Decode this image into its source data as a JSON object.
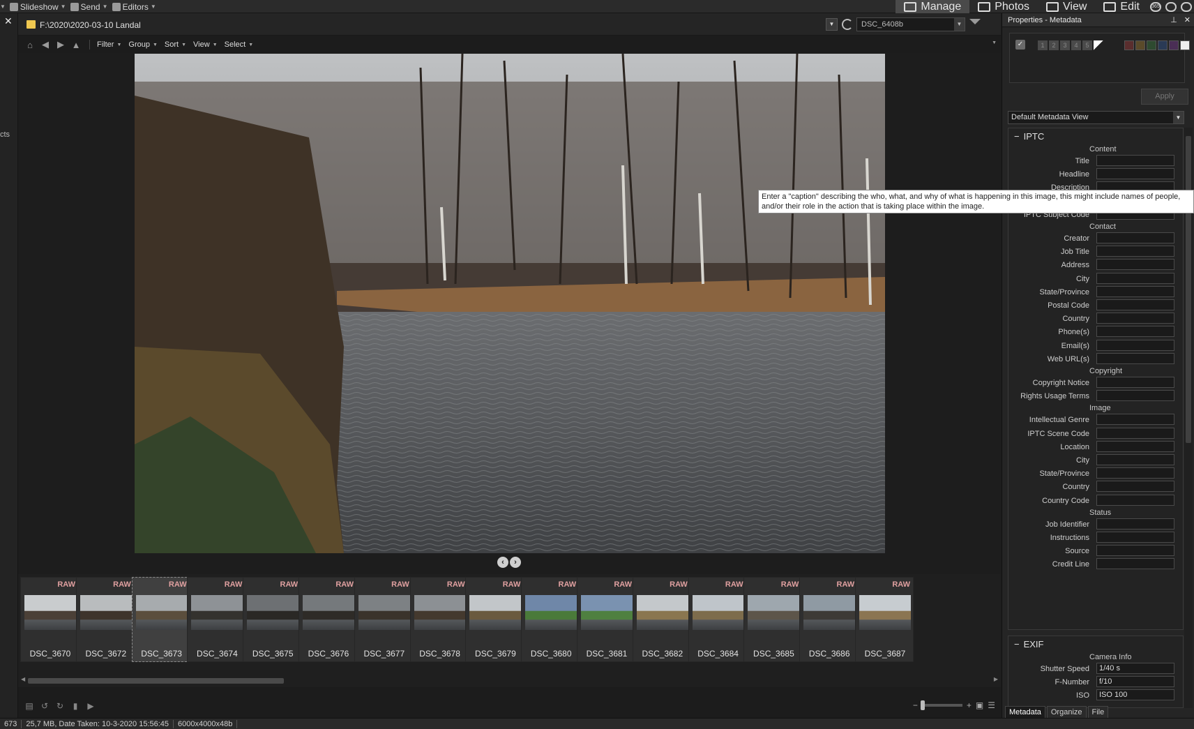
{
  "topbar": {
    "left_items": [
      {
        "label": "Slideshow",
        "icon": "slideshow-icon"
      },
      {
        "label": "Send",
        "icon": "send-icon"
      },
      {
        "label": "Editors",
        "icon": "editors-icon"
      }
    ],
    "modes": [
      {
        "label": "Manage",
        "icon": "grid-icon",
        "active": true
      },
      {
        "label": "Photos",
        "icon": "photos-icon",
        "active": false
      },
      {
        "label": "View",
        "icon": "eye-icon",
        "active": false
      },
      {
        "label": "Edit",
        "icon": "edit-icon",
        "active": false
      }
    ],
    "mini_icons": [
      "365",
      "",
      ""
    ]
  },
  "leftrail": {
    "truncated": "cts"
  },
  "pathbar": {
    "path": "F:\\2020\\2020-03-10 Landal",
    "search_value": "DSC_6408b"
  },
  "toolbar": {
    "menus": [
      "Filter",
      "Group",
      "Sort",
      "View",
      "Select"
    ]
  },
  "filmstrip": {
    "badge": "RAW",
    "selected_index": 2,
    "items": [
      {
        "label": "DSC_3670",
        "sky": "#c9ccce",
        "ground": "#4b4037"
      },
      {
        "label": "DSC_3672",
        "sky": "#b9bcbe",
        "ground": "#3e342c"
      },
      {
        "label": "DSC_3673",
        "sky": "#a7abae",
        "ground": "#5b4e3d"
      },
      {
        "label": "DSC_3674",
        "sky": "#8e9296",
        "ground": "#34322e"
      },
      {
        "label": "DSC_3675",
        "sky": "#6d7073",
        "ground": "#2a2825"
      },
      {
        "label": "DSC_3676",
        "sky": "#75797c",
        "ground": "#2e2b27"
      },
      {
        "label": "DSC_3677",
        "sky": "#7d8184",
        "ground": "#3a332b"
      },
      {
        "label": "DSC_3678",
        "sky": "#8c9094",
        "ground": "#44392e"
      },
      {
        "label": "DSC_3679",
        "sky": "#c2c6c9",
        "ground": "#6a5a3f"
      },
      {
        "label": "DSC_3680",
        "sky": "#6f87a8",
        "ground": "#4a7a3a"
      },
      {
        "label": "DSC_3681",
        "sky": "#7a92b0",
        "ground": "#4f8040"
      },
      {
        "label": "DSC_3682",
        "sky": "#c4c8cb",
        "ground": "#8a7650"
      },
      {
        "label": "DSC_3684",
        "sky": "#bfc5ca",
        "ground": "#7d6c4c"
      },
      {
        "label": "DSC_3685",
        "sky": "#9ea7ae",
        "ground": "#5d554a"
      },
      {
        "label": "DSC_3686",
        "sky": "#8f9aa3",
        "ground": "#3d3a36"
      },
      {
        "label": "DSC_3687",
        "sky": "#c7ccd0",
        "ground": "#8b7552"
      }
    ]
  },
  "status": {
    "count": "673",
    "info": "25,7 MB, Date Taken: 10-3-2020 15:56:45",
    "dims": "6000x4000x48b"
  },
  "panel": {
    "title": "Properties - Metadata",
    "apply": "Apply",
    "metadata_view": "Default Metadata View",
    "iptc_title": "IPTC",
    "exif_title": "EXIF",
    "tooltip": "Enter a \"caption\" describing the who, what, and why of what is happening in this image, this might include names of people, and/or their role in the action that is taking place within the image.",
    "iptc_groups": [
      {
        "title": "Content",
        "fields": [
          "Title",
          "Headline",
          "Description",
          "",
          "IPTC Subject Code"
        ]
      },
      {
        "title": "Contact",
        "fields": [
          "Creator",
          "Job Title",
          "Address",
          "City",
          "State/Province",
          "Postal Code",
          "Country",
          "Phone(s)",
          "Email(s)",
          "Web URL(s)"
        ]
      },
      {
        "title": "Copyright",
        "fields": [
          "Copyright Notice",
          "Rights Usage Terms"
        ]
      },
      {
        "title": "Image",
        "fields": [
          "Intellectual Genre",
          "IPTC Scene Code",
          "Location",
          "City",
          "State/Province",
          "Country",
          "Country Code"
        ]
      },
      {
        "title": "Status",
        "fields": [
          "Job Identifier",
          "Instructions",
          "Source",
          "Credit Line"
        ]
      }
    ],
    "exif_group": "Camera Info",
    "exif_fields": [
      {
        "label": "Shutter Speed",
        "value": "1/40 s"
      },
      {
        "label": "F-Number",
        "value": "f/10"
      },
      {
        "label": "ISO",
        "value": "ISO 100"
      }
    ],
    "tabs": [
      {
        "label": "Metadata",
        "active": true
      },
      {
        "label": "Organize",
        "active": false
      },
      {
        "label": "File",
        "active": false
      }
    ]
  }
}
